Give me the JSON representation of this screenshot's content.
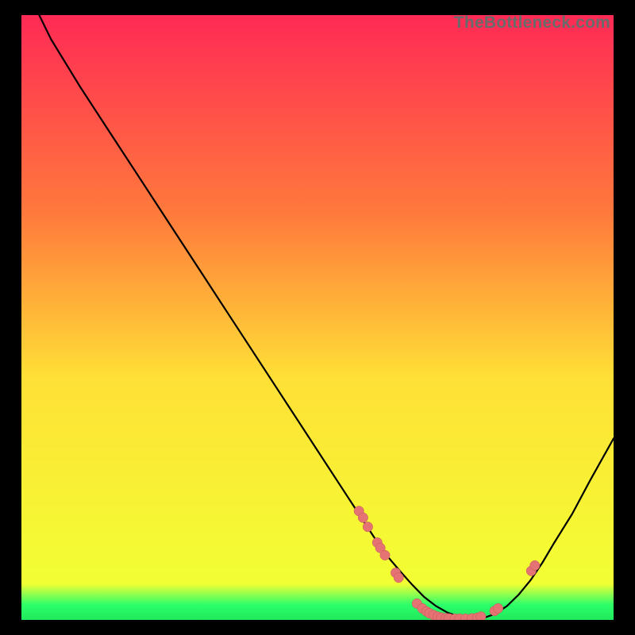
{
  "watermark": "TheBottleneck.com",
  "colors": {
    "background": "#000000",
    "gradient_top": "#ff2a55",
    "gradient_upper": "#ff7a3c",
    "gradient_mid": "#ffe036",
    "gradient_lower": "#f2ff33",
    "gradient_band": "#2cff6a",
    "curve_stroke": "#000000",
    "marker_fill": "#e57373",
    "marker_stroke": "#c25757"
  },
  "chart_data": {
    "type": "line",
    "title": "",
    "xlabel": "",
    "ylabel": "",
    "xlim": [
      0,
      100
    ],
    "ylim": [
      0,
      100
    ],
    "grid": false,
    "legend": null,
    "series": [
      {
        "name": "bottleneck-curve",
        "x": [
          3,
          5,
          10,
          15,
          20,
          25,
          30,
          35,
          40,
          45,
          50,
          55,
          58,
          60,
          62,
          64,
          66,
          68,
          70,
          72,
          74,
          76,
          78,
          80,
          82,
          84,
          86,
          88,
          90,
          93,
          96,
          100
        ],
        "y": [
          100,
          96,
          88,
          80.5,
          73,
          65.5,
          58,
          50.5,
          43,
          35.5,
          28,
          20.5,
          16,
          13,
          10.3,
          8,
          5.8,
          3.8,
          2.3,
          1.2,
          0.5,
          0.2,
          0.3,
          1,
          2.3,
          4.2,
          6.6,
          9.5,
          12.8,
          17.5,
          23,
          30
        ]
      }
    ],
    "markers": [
      {
        "x": 57.0,
        "y": 18.0
      },
      {
        "x": 57.7,
        "y": 16.9
      },
      {
        "x": 58.5,
        "y": 15.4
      },
      {
        "x": 60.1,
        "y": 12.8
      },
      {
        "x": 60.6,
        "y": 11.9
      },
      {
        "x": 61.4,
        "y": 10.7
      },
      {
        "x": 63.2,
        "y": 7.8
      },
      {
        "x": 63.7,
        "y": 7.0
      },
      {
        "x": 66.8,
        "y": 2.7
      },
      {
        "x": 67.7,
        "y": 1.9
      },
      {
        "x": 68.4,
        "y": 1.4
      },
      {
        "x": 68.9,
        "y": 1.1
      },
      {
        "x": 69.6,
        "y": 0.8
      },
      {
        "x": 70.3,
        "y": 0.55
      },
      {
        "x": 70.9,
        "y": 0.4
      },
      {
        "x": 71.7,
        "y": 0.3
      },
      {
        "x": 72.2,
        "y": 0.25
      },
      {
        "x": 73.2,
        "y": 0.2
      },
      {
        "x": 74.0,
        "y": 0.2
      },
      {
        "x": 75.0,
        "y": 0.2
      },
      {
        "x": 76.1,
        "y": 0.25
      },
      {
        "x": 77.0,
        "y": 0.35
      },
      {
        "x": 77.6,
        "y": 0.55
      },
      {
        "x": 79.9,
        "y": 1.5
      },
      {
        "x": 80.5,
        "y": 1.9
      },
      {
        "x": 86.1,
        "y": 8.1
      },
      {
        "x": 86.7,
        "y": 9.0
      }
    ]
  }
}
